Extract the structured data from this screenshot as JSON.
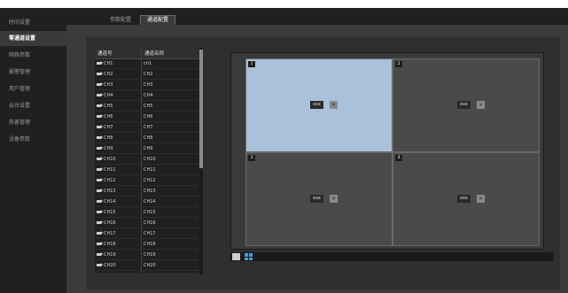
{
  "sidebar": {
    "items": [
      {
        "label": "时间设置",
        "active": false
      },
      {
        "label": "零通道设置",
        "active": true
      },
      {
        "label": "网络参数",
        "active": false
      },
      {
        "label": "报警管理",
        "active": false
      },
      {
        "label": "用户管理",
        "active": false
      },
      {
        "label": "云台设置",
        "active": false
      },
      {
        "label": "热备管理",
        "active": false
      },
      {
        "label": "设备参数",
        "active": false
      }
    ]
  },
  "tabs": [
    {
      "label": "参数配置",
      "active": false
    },
    {
      "label": "通道配置",
      "active": true
    }
  ],
  "channel_table": {
    "headers": [
      "通道号",
      "通道名称"
    ],
    "rows": [
      {
        "no": "CH1",
        "name": "ch1"
      },
      {
        "no": "CH2",
        "name": "CH2"
      },
      {
        "no": "CH3",
        "name": "CH3"
      },
      {
        "no": "CH4",
        "name": "CH4"
      },
      {
        "no": "CH5",
        "name": "CH5"
      },
      {
        "no": "CH6",
        "name": "CH6"
      },
      {
        "no": "CH7",
        "name": "CH7"
      },
      {
        "no": "CH8",
        "name": "CH8"
      },
      {
        "no": "CH9",
        "name": "CH9"
      },
      {
        "no": "CH10",
        "name": "CH10"
      },
      {
        "no": "CH11",
        "name": "CH11"
      },
      {
        "no": "CH12",
        "name": "CH12"
      },
      {
        "no": "CH13",
        "name": "CH13"
      },
      {
        "no": "CH14",
        "name": "CH14"
      },
      {
        "no": "CH15",
        "name": "CH15"
      },
      {
        "no": "CH16",
        "name": "CH16"
      },
      {
        "no": "CH17",
        "name": "CH17"
      },
      {
        "no": "CH18",
        "name": "CH18"
      },
      {
        "no": "CH19",
        "name": "CH19"
      },
      {
        "no": "CH20",
        "name": "CH20"
      }
    ]
  },
  "preview": {
    "cells": [
      {
        "num": "1",
        "label": "xxx",
        "close": "×",
        "selected": true
      },
      {
        "num": "2",
        "label": "xxx",
        "close": "×",
        "selected": false
      },
      {
        "num": "3",
        "label": "xxx",
        "close": "×",
        "selected": false
      },
      {
        "num": "4",
        "label": "xxx",
        "close": "×",
        "selected": false
      }
    ]
  },
  "layout_buttons": [
    "single-layout-icon",
    "quad-layout-icon"
  ],
  "colors": {
    "panel_bg": "#202020",
    "content_bg": "#3b3b3b",
    "selected_cell": "#a9c1d9",
    "accent": "#3aa0e0"
  }
}
